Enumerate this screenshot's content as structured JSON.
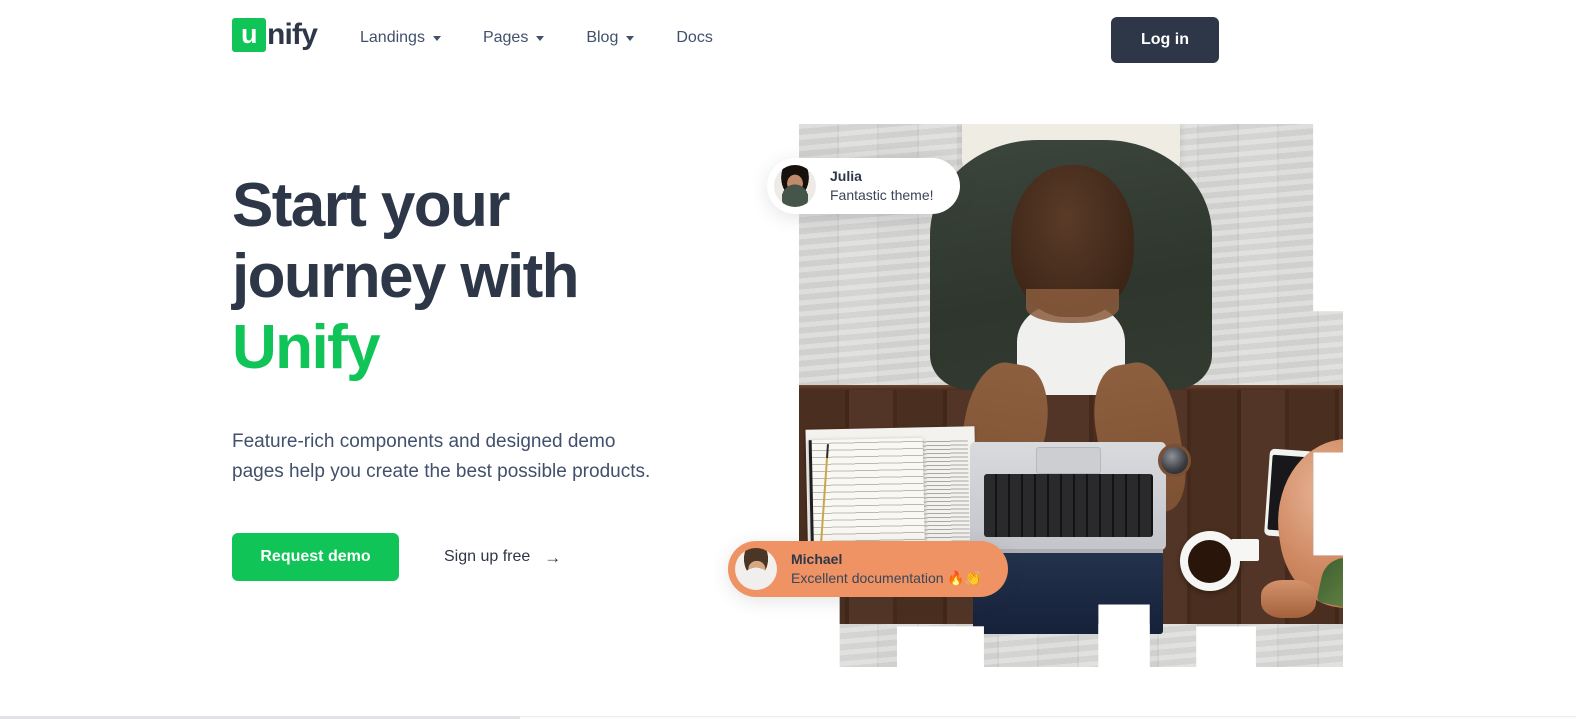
{
  "header": {
    "brand": {
      "mark_letter": "u",
      "word": "nify"
    },
    "nav": [
      {
        "label": "Landings",
        "has_dropdown": true
      },
      {
        "label": "Pages",
        "has_dropdown": true
      },
      {
        "label": "Blog",
        "has_dropdown": true
      },
      {
        "label": "Docs",
        "has_dropdown": false
      }
    ],
    "login_label": "Log in"
  },
  "hero": {
    "title_line1": "Start your",
    "title_line2": "journey with",
    "title_accent": "Unify",
    "subtitle": "Feature-rich components and designed demo pages help you create the best possible products.",
    "primary_cta": "Request demo",
    "secondary_cta": "Sign up free",
    "secondary_cta_arrow": "→"
  },
  "testimonials": [
    {
      "name": "Julia",
      "quote": "Fantastic theme!",
      "avatar": "julia-avatar",
      "style": "light"
    },
    {
      "name": "Michael",
      "quote": "Excellent documentation 🔥👏",
      "avatar": "michael-avatar",
      "style": "orange"
    }
  ],
  "colors": {
    "brand_green": "#10c457",
    "dark_navy": "#2d3748",
    "body_text": "#41506b",
    "pill_orange": "#ef9264",
    "page_bg": "#ffffff"
  }
}
